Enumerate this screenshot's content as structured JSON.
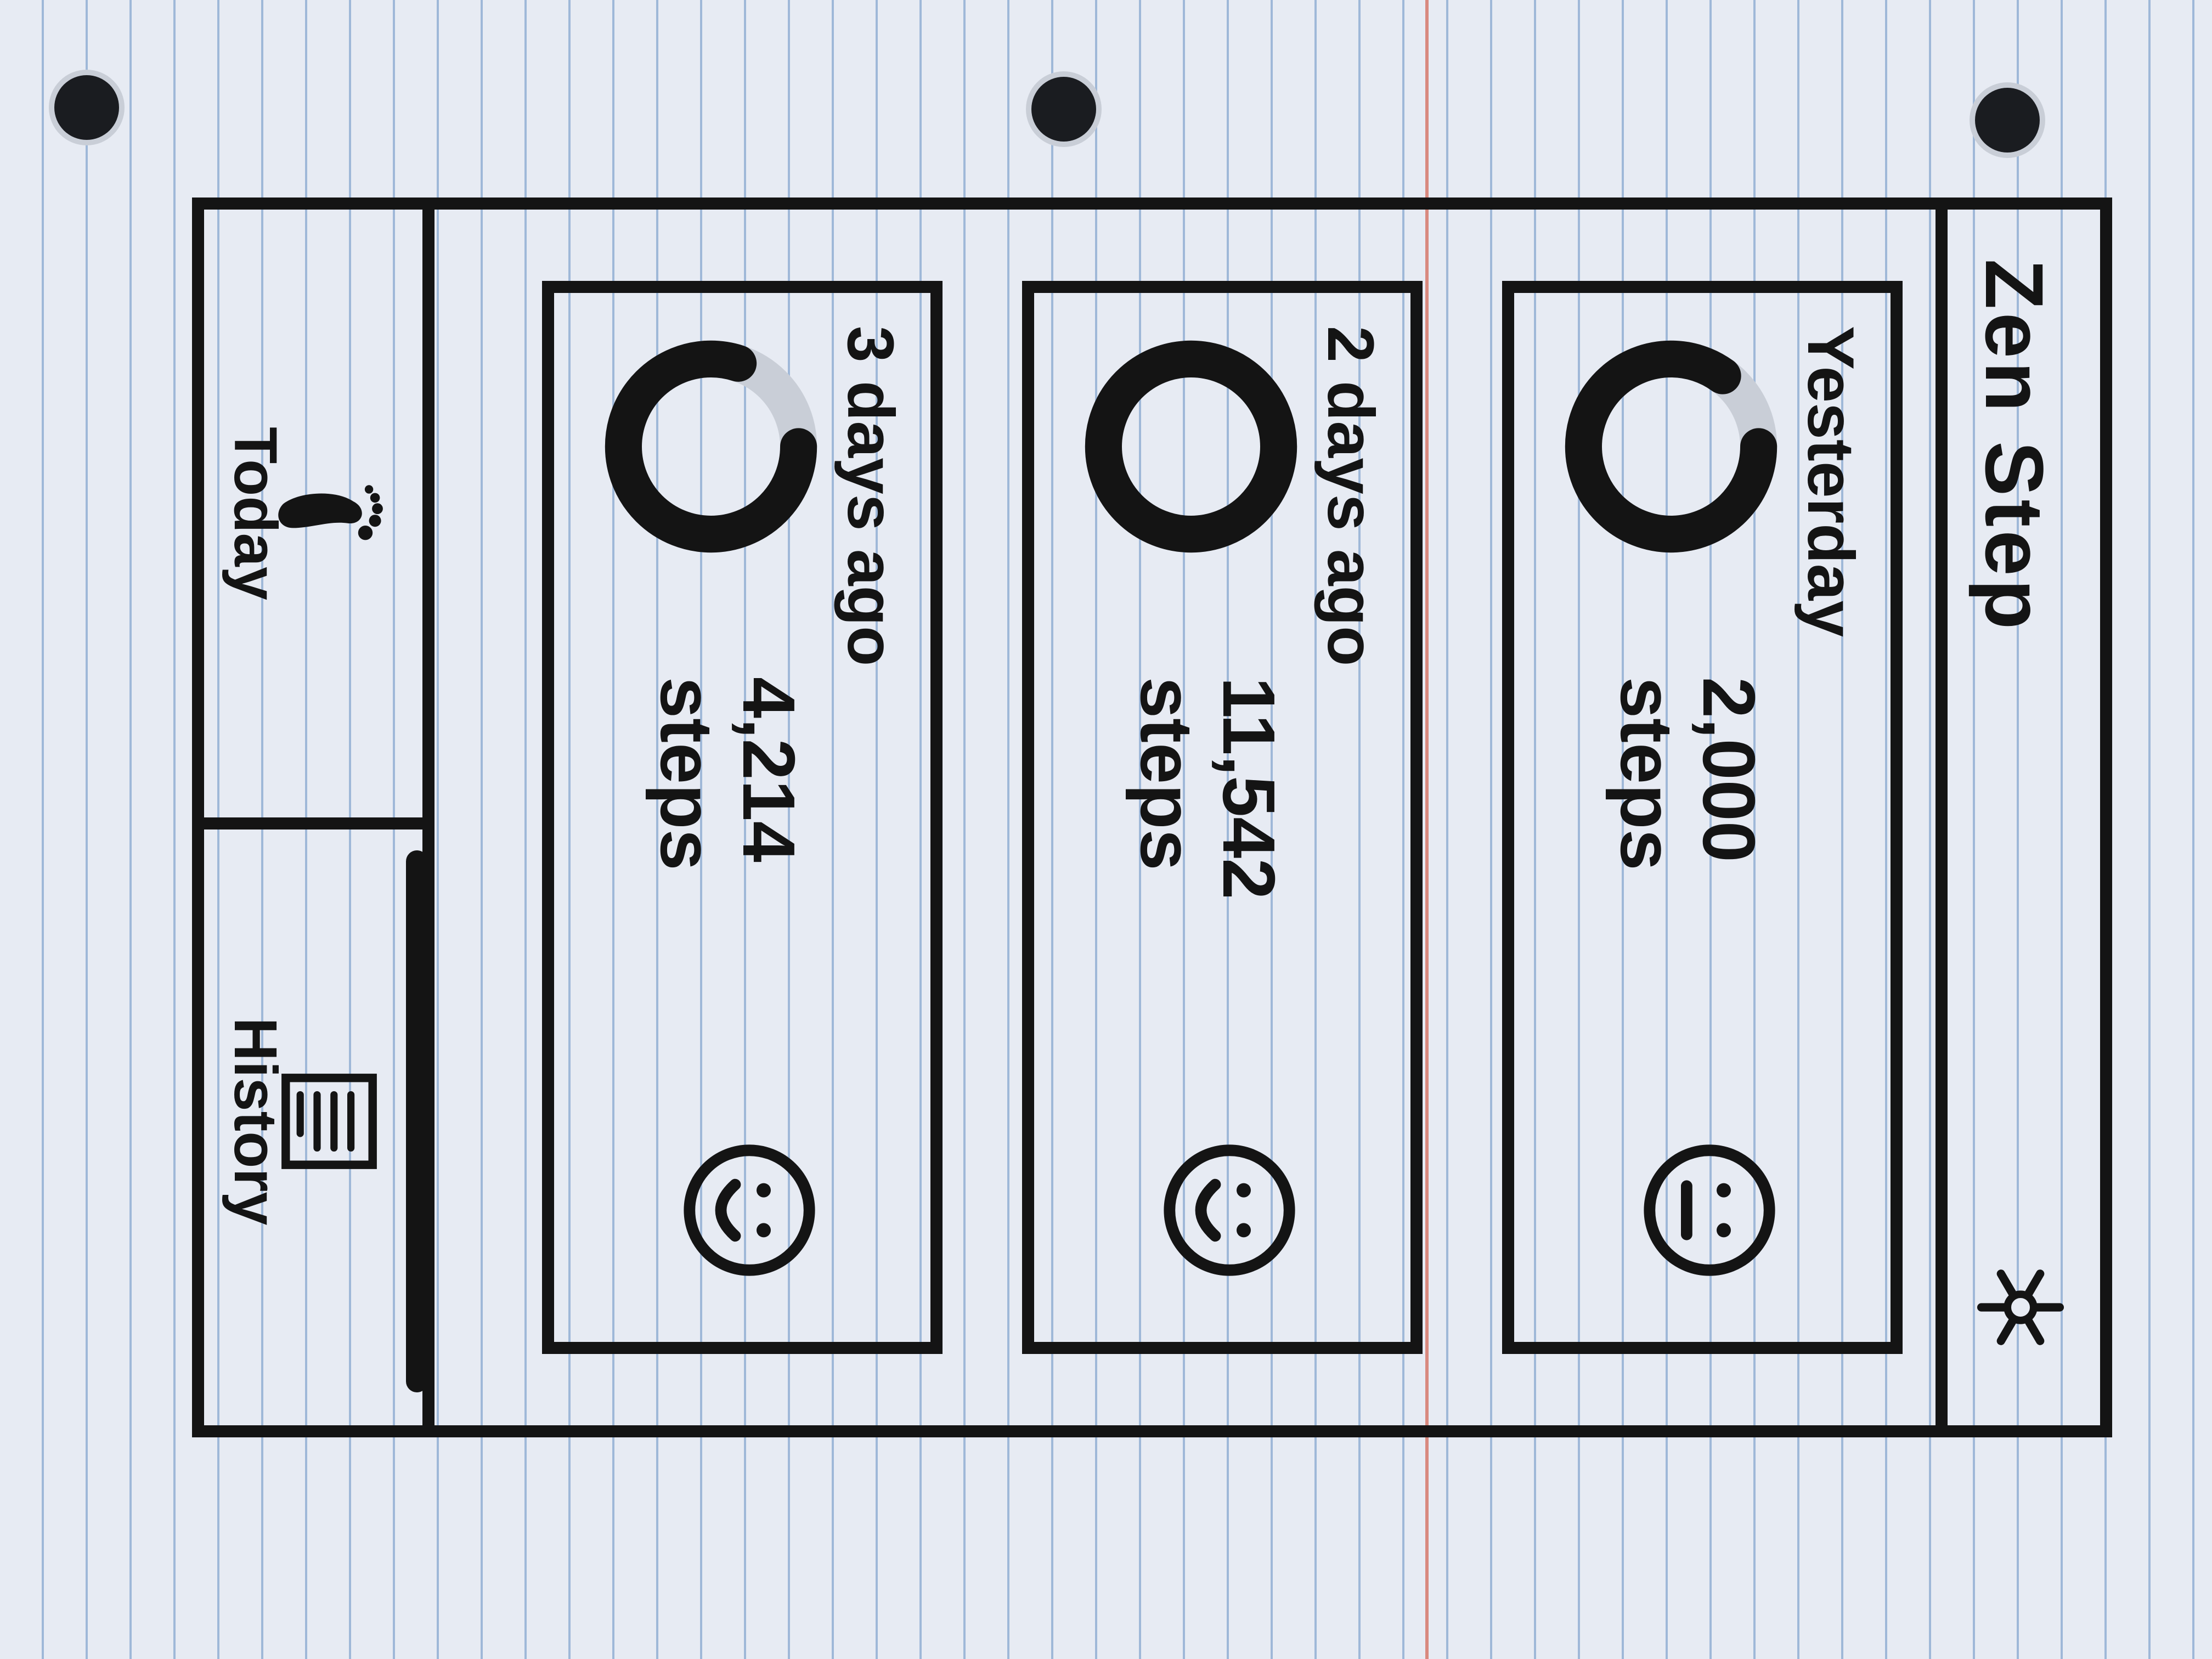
{
  "app": {
    "title": "Zen Step"
  },
  "header": {
    "settings_icon": "gear-icon"
  },
  "cards": [
    {
      "label": "Yesterday",
      "steps": "2,000",
      "unit": "steps",
      "progress": 0.85,
      "mood": "neutral-face-icon"
    },
    {
      "label": "2 days ago",
      "steps": "11,542",
      "unit": "steps",
      "progress": 1.0,
      "mood": "smile-face-icon"
    },
    {
      "label": "3 days ago",
      "steps": "4,214",
      "unit": "steps",
      "progress": 0.8,
      "mood": "smile-face-icon"
    }
  ],
  "nav": {
    "items": [
      {
        "label": "Today",
        "icon": "footprint-icon"
      },
      {
        "label": "History",
        "icon": "list-icon",
        "active": true
      }
    ]
  },
  "colors": {
    "ink": "#141414",
    "paper": "#e7ebf3",
    "ruled_line": "#9fb8d8",
    "margin_line": "#d9897f"
  }
}
